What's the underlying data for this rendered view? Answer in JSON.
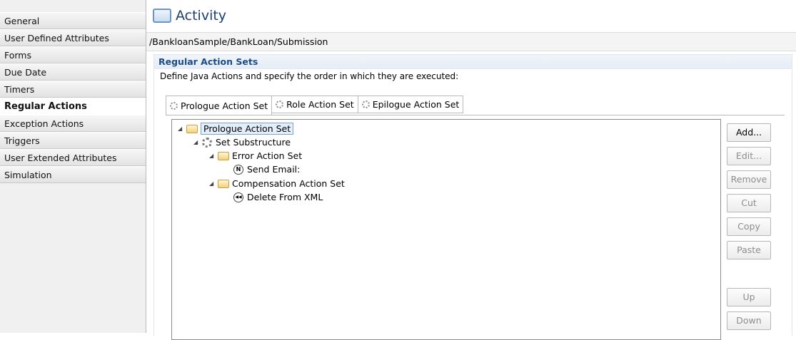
{
  "sidebar": {
    "items": [
      {
        "label": "General"
      },
      {
        "label": "User Defined Attributes"
      },
      {
        "label": "Forms"
      },
      {
        "label": "Due Date"
      },
      {
        "label": "Timers"
      },
      {
        "label": "Regular Actions",
        "active": true
      },
      {
        "label": "Exception Actions"
      },
      {
        "label": "Triggers"
      },
      {
        "label": "User Extended Attributes"
      },
      {
        "label": "Simulation"
      }
    ]
  },
  "header": {
    "title": "Activity",
    "path": "/BankloanSample/BankLoan/Submission"
  },
  "section": {
    "title": "Regular Action Sets",
    "description": "Define Java Actions and specify the order in which they are executed:"
  },
  "tabs": [
    {
      "label": "Prologue Action Set",
      "icon": "gear-icon",
      "active": true
    },
    {
      "label": "Role Action Set",
      "icon": "gear-icon"
    },
    {
      "label": "Epilogue Action Set",
      "icon": "gear-icon"
    }
  ],
  "tree": {
    "root": {
      "label": "Prologue Action Set",
      "icon": "folder-open-icon",
      "selected": true
    },
    "substructure": {
      "label": "Set Substructure",
      "icon": "gear-icon"
    },
    "error_set": {
      "label": "Error Action Set",
      "icon": "folder-open-icon"
    },
    "send_email": {
      "label": "Send Email:",
      "icon": "email-action-icon",
      "glyph": "N"
    },
    "compensation_set": {
      "label": "Compensation Action Set",
      "icon": "folder-open-icon"
    },
    "delete_xml": {
      "label": "Delete From XML",
      "icon": "rewind-action-icon",
      "glyph": "◀◀"
    }
  },
  "buttons": {
    "add": "Add...",
    "edit": "Edit...",
    "remove": "Remove",
    "cut": "Cut",
    "copy": "Copy",
    "paste": "Paste",
    "up": "Up",
    "down": "Down"
  },
  "colors": {
    "title": "#1c3f6f",
    "section_title": "#1c4c86",
    "selection": "#e3eefb",
    "disabled_text": "#8d8d8d"
  }
}
